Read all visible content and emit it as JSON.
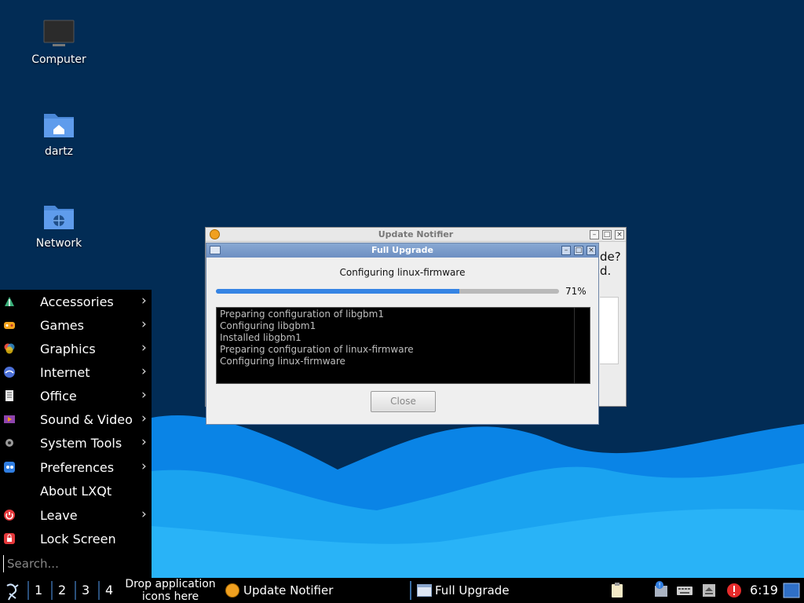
{
  "desktop": {
    "icons": [
      {
        "label": "Computer"
      },
      {
        "label": "dartz"
      },
      {
        "label": "Network"
      }
    ]
  },
  "update_notifier": {
    "title": "Update Notifier",
    "partial_text_line1": "de?",
    "partial_text_line2": "d."
  },
  "full_upgrade": {
    "title": "Full Upgrade",
    "status": "Configuring linux-firmware",
    "progress_percent": 71,
    "progress_label": "71%",
    "log": [
      "Preparing configuration of libgbm1",
      "Configuring libgbm1",
      "Installed libgbm1",
      "Preparing configuration of linux-firmware",
      "Configuring linux-firmware"
    ],
    "close_label": "Close"
  },
  "menu": {
    "items": [
      {
        "label": "Accessories",
        "icon": "accessories-icon",
        "submenu": true
      },
      {
        "label": "Games",
        "icon": "games-icon",
        "submenu": true
      },
      {
        "label": "Graphics",
        "icon": "graphics-icon",
        "submenu": true
      },
      {
        "label": "Internet",
        "icon": "internet-icon",
        "submenu": true
      },
      {
        "label": "Office",
        "icon": "office-icon",
        "submenu": true
      },
      {
        "label": "Sound & Video",
        "icon": "sound-video-icon",
        "submenu": true
      },
      {
        "label": "System Tools",
        "icon": "system-tools-icon",
        "submenu": true
      },
      {
        "label": "Preferences",
        "icon": "preferences-icon",
        "submenu": true
      },
      {
        "label": "About LXQt",
        "icon": "",
        "submenu": false
      },
      {
        "label": "Leave",
        "icon": "leave-icon",
        "submenu": true
      },
      {
        "label": "Lock Screen",
        "icon": "lock-icon",
        "submenu": false
      }
    ],
    "search_placeholder": "Search..."
  },
  "taskbar": {
    "desktops": [
      "1",
      "2",
      "3",
      "4"
    ],
    "quicklaunch_line1": "Drop application",
    "quicklaunch_line2": "icons here",
    "tasks": [
      {
        "label": "Update Notifier"
      },
      {
        "label": "Full Upgrade"
      }
    ],
    "clock": "6:19"
  },
  "colors": {
    "desktop_bg": "#022c55",
    "wave_light": "#1aa3f0",
    "wave_dark": "#0077d9",
    "progress_fill": "#3584e4",
    "menu_bg": "#000000"
  }
}
